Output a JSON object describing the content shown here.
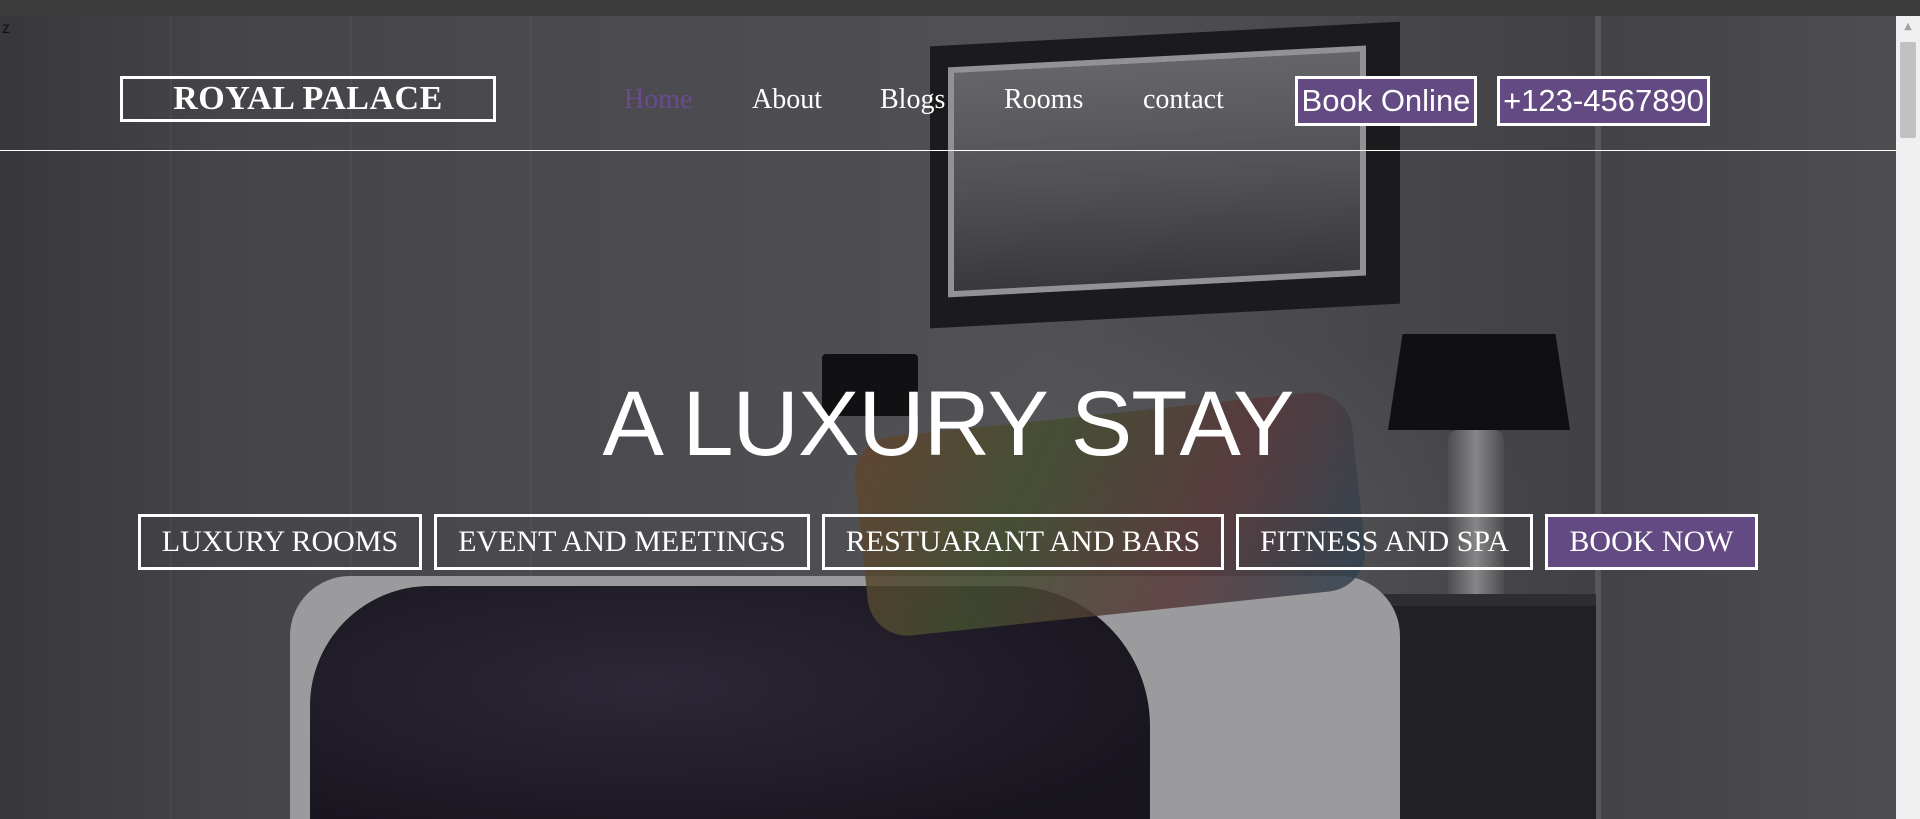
{
  "page": {
    "corner_char": "z"
  },
  "header": {
    "logo": "ROYAL PALACE",
    "nav": [
      {
        "label": "Home",
        "active": true
      },
      {
        "label": "About",
        "active": false
      },
      {
        "label": "Blogs",
        "active": false
      },
      {
        "label": "Rooms",
        "active": false
      },
      {
        "label": "contact",
        "active": false
      }
    ],
    "book_online_label": "Book Online",
    "phone_label": "+123-4567890"
  },
  "hero": {
    "title": "A LUXURY STAY",
    "buttons": [
      {
        "label": "LUXURY ROOMS",
        "primary": false
      },
      {
        "label": "EVENT AND MEETINGS",
        "primary": false
      },
      {
        "label": "RESTUARANT AND BARS",
        "primary": false
      },
      {
        "label": "FITNESS AND SPA",
        "primary": false
      },
      {
        "label": "BOOK NOW",
        "primary": true
      }
    ]
  },
  "colors": {
    "accent": "#634a82",
    "active_link": "#6a4b8f",
    "text": "#ffffff"
  },
  "icons": {
    "scroll_up": "chevron-up-icon"
  }
}
